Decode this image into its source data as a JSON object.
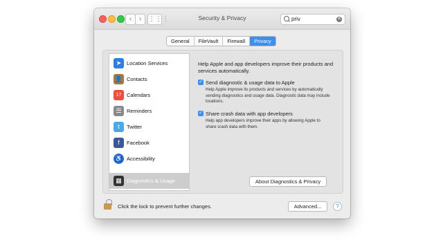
{
  "window": {
    "title": "Security & Privacy"
  },
  "toolbar": {
    "back": "‹",
    "forward": "›",
    "grid": "⋮⋮⋮"
  },
  "search": {
    "value": "priv",
    "clear": "✕"
  },
  "tabs": [
    {
      "label": "General"
    },
    {
      "label": "FileVault"
    },
    {
      "label": "Firewall"
    },
    {
      "label": "Privacy"
    }
  ],
  "sidebar": {
    "items": [
      {
        "label": "Location Services",
        "icon": "➤",
        "color": "#2f7ee6"
      },
      {
        "label": "Contacts",
        "icon": "👤",
        "color": "#a7773b"
      },
      {
        "label": "Calendars",
        "icon": "17",
        "color": "#ef4d3e"
      },
      {
        "label": "Reminders",
        "icon": "☰",
        "color": "#8a8a8a"
      },
      {
        "label": "Twitter",
        "icon": "t",
        "color": "#4aa9e9"
      },
      {
        "label": "Facebook",
        "icon": "f",
        "color": "#3b5998"
      },
      {
        "label": "Accessibility",
        "icon": "♿",
        "color": "#1c6fd8"
      },
      {
        "label": "Diagnostics & Usage",
        "icon": "▦",
        "color": "#333333"
      }
    ]
  },
  "content": {
    "intro": "Help Apple and app developers improve their products and services automatically.",
    "options": [
      {
        "label": "Send diagnostic & usage data to Apple",
        "checked": "✓",
        "desc": "Help Apple improve its products and services by automatically sending diagnostics and usage data. Diagnostic data may include locations."
      },
      {
        "label": "Share crash data with app developers",
        "checked": "✓",
        "desc": "Help app developers improve their apps by allowing Apple to share crash data with them."
      }
    ],
    "about_button": "About Diagnostics & Privacy"
  },
  "footer": {
    "lock_text": "Click the lock to prevent further changes.",
    "advanced_button": "Advanced...",
    "help": "?"
  },
  "colors": {
    "accent": "#3d8ef4"
  }
}
